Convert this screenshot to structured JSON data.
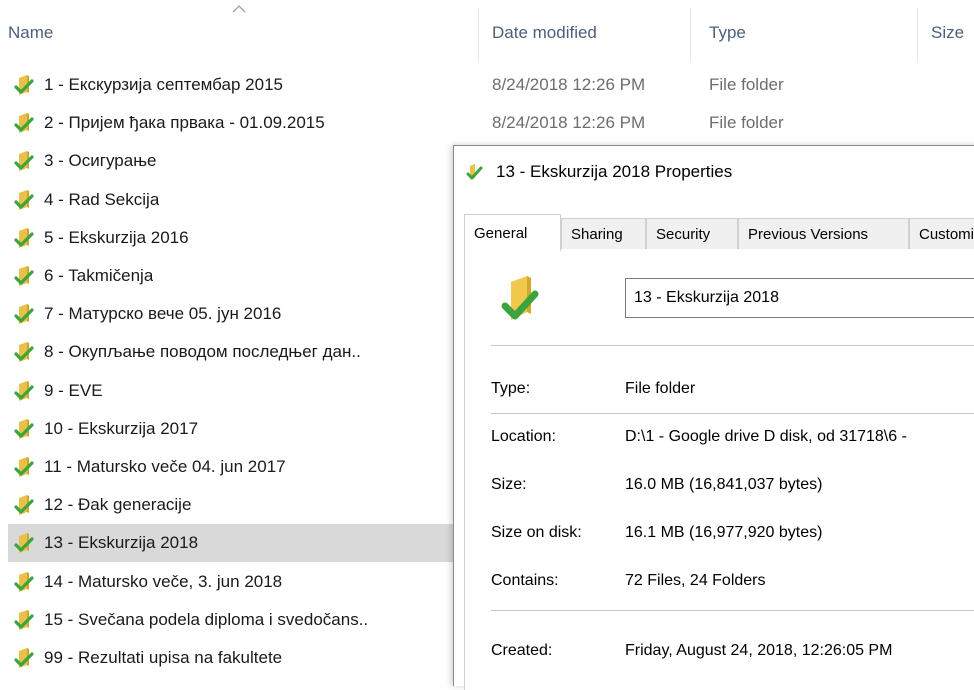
{
  "explorer": {
    "columns": {
      "name": "Name",
      "date_modified": "Date modified",
      "type": "Type",
      "size": "Size"
    },
    "rows": [
      {
        "name": "1 - Екскурзија септембар 2015",
        "date": "8/24/2018 12:26 PM",
        "type": "File folder"
      },
      {
        "name": "2 - Пријем ђака првака - 01.09.2015",
        "date": "8/24/2018 12:26 PM",
        "type": "File folder"
      },
      {
        "name": "3 - Осигурање"
      },
      {
        "name": "4 - Rad Sekcija"
      },
      {
        "name": "5 - Ekskurzija 2016"
      },
      {
        "name": "6 - Takmičenja"
      },
      {
        "name": "7 - Матурско вече 05. јун 2016"
      },
      {
        "name": "8 - Окупљање поводом последњег дан.."
      },
      {
        "name": "9 - EVE"
      },
      {
        "name": "10 - Ekskurzija 2017"
      },
      {
        "name": "11 - Matursko veče 04. jun 2017"
      },
      {
        "name": "12 - Đak generacije"
      },
      {
        "name": "13 - Ekskurzija 2018",
        "selected": true
      },
      {
        "name": "14 - Matursko veče, 3. jun 2018"
      },
      {
        "name": "15 - Svečana podela diploma i svedočans.."
      },
      {
        "name": "99 - Rezultati upisa na fakultete"
      }
    ],
    "folder_icon": "folder-sync-check-icon",
    "colors": {
      "folder": "#e8c14a",
      "check": "#3da33c",
      "selection": "#d9d9d9",
      "header_text": "#4c607a"
    }
  },
  "dialog": {
    "title": "13 - Ekskurzija 2018 Properties",
    "tabs": [
      "General",
      "Sharing",
      "Security",
      "Previous Versions",
      "Customize"
    ],
    "active_tab": "General",
    "folder_name": "13 - Ekskurzija 2018",
    "props": {
      "type_label": "Type:",
      "type_value": "File folder",
      "location_label": "Location:",
      "location_value": "D:\\1 - Google drive D disk, od 31718\\6 - ",
      "size_label": "Size:",
      "size_value": "16.0 MB (16,841,037 bytes)",
      "size_on_disk_label": "Size on disk:",
      "size_on_disk_value": "16.1 MB (16,977,920 bytes)",
      "contains_label": "Contains:",
      "contains_value": "72 Files, 24 Folders",
      "created_label": "Created:",
      "created_value": "Friday, August 24, 2018, 12:26:05 PM"
    }
  }
}
